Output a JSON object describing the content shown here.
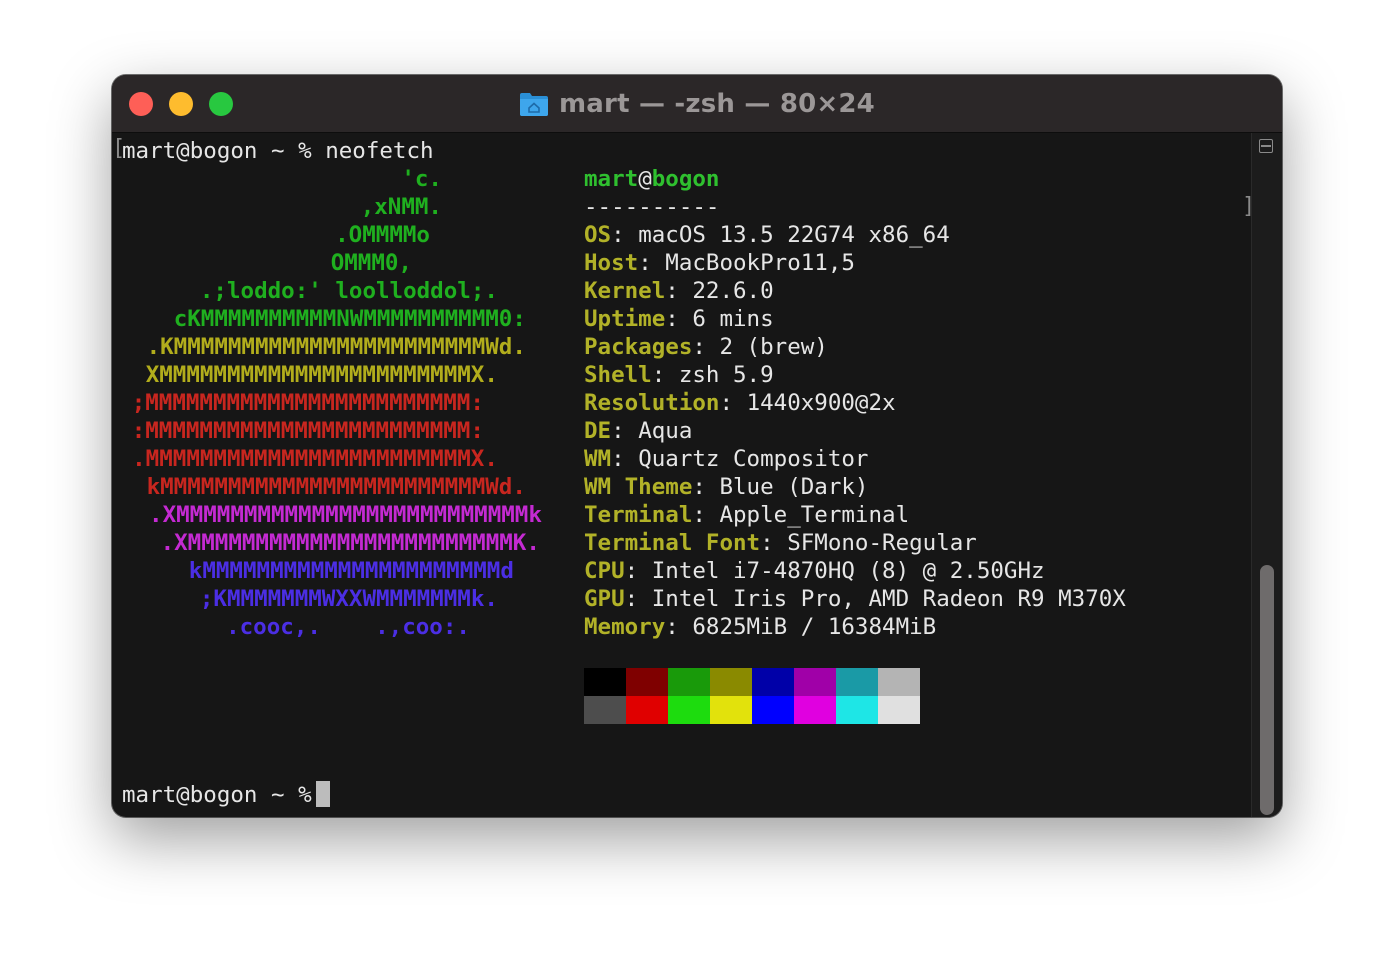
{
  "window": {
    "title": "mart — -zsh — 80×24",
    "traffic_lights": {
      "close": "#fe5f57",
      "minimize": "#febc2e",
      "zoom": "#28c840"
    }
  },
  "terminal": {
    "command_line": "mart@bogon ~ % neofetch",
    "prompt": "mart@bogon ~ %",
    "logo": [
      {
        "text": "'c.",
        "color": "green"
      },
      {
        "text": ",xNMM.",
        "color": "green"
      },
      {
        "text": ".OMMMMo",
        "color": "green"
      },
      {
        "text": "OMMM0,",
        "color": "green"
      },
      {
        "text": ".;loddo:' loolloddol;.",
        "color": "green"
      },
      {
        "text": "cKMMMMMMMMMMNWMMMMMMMMMM0:",
        "color": "green"
      },
      {
        "text": ".KMMMMMMMMMMMMMMMMMMMMMMMWd.",
        "color": "yellow"
      },
      {
        "text": "XMMMMMMMMMMMMMMMMMMMMMMMX.",
        "color": "yellow"
      },
      {
        "text": ";MMMMMMMMMMMMMMMMMMMMMMMM:",
        "color": "red"
      },
      {
        "text": ":MMMMMMMMMMMMMMMMMMMMMMMM:",
        "color": "red"
      },
      {
        "text": ".MMMMMMMMMMMMMMMMMMMMMMMMX.",
        "color": "red"
      },
      {
        "text": "kMMMMMMMMMMMMMMMMMMMMMMMMWd.",
        "color": "red"
      },
      {
        "text": ".XMMMMMMMMMMMMMMMMMMMMMMMMMMk",
        "color": "magenta"
      },
      {
        "text": ".XMMMMMMMMMMMMMMMMMMMMMMMMK.",
        "color": "magenta"
      },
      {
        "text": "kMMMMMMMMMMMMMMMMMMMMMMd",
        "color": "blue"
      },
      {
        "text": ";KMMMMMMMWXXWMMMMMMMk.",
        "color": "blue"
      },
      {
        "text": ".cooc,.    .,coo:.",
        "color": "blue"
      }
    ],
    "header": {
      "user": "mart",
      "at": "@",
      "host": "bogon",
      "separator": "----------"
    },
    "info": [
      {
        "label": "OS",
        "value": "macOS 13.5 22G74 x86_64"
      },
      {
        "label": "Host",
        "value": "MacBookPro11,5"
      },
      {
        "label": "Kernel",
        "value": "22.6.0"
      },
      {
        "label": "Uptime",
        "value": "6 mins"
      },
      {
        "label": "Packages",
        "value": "2 (brew)"
      },
      {
        "label": "Shell",
        "value": "zsh 5.9"
      },
      {
        "label": "Resolution",
        "value": "1440x900@2x"
      },
      {
        "label": "DE",
        "value": "Aqua"
      },
      {
        "label": "WM",
        "value": "Quartz Compositor"
      },
      {
        "label": "WM Theme",
        "value": "Blue (Dark)"
      },
      {
        "label": "Terminal",
        "value": "Apple_Terminal"
      },
      {
        "label": "Terminal Font",
        "value": "SFMono-Regular"
      },
      {
        "label": "CPU",
        "value": "Intel i7-4870HQ (8) @ 2.50GHz"
      },
      {
        "label": "GPU",
        "value": "Intel Iris Pro, AMD Radeon R9 M370X"
      },
      {
        "label": "Memory",
        "value": "6825MiB / 16384MiB"
      }
    ],
    "palette": {
      "normal": [
        "#000000",
        "#7f0000",
        "#199a0a",
        "#8a8a00",
        "#0000a8",
        "#a000a8",
        "#1a9aa6",
        "#b4b4b4"
      ],
      "bright": [
        "#4d4d4d",
        "#e00000",
        "#1ddc0e",
        "#e2e20c",
        "#0000ff",
        "#e000e0",
        "#1ee6e6",
        "#e0e0e0"
      ]
    }
  }
}
